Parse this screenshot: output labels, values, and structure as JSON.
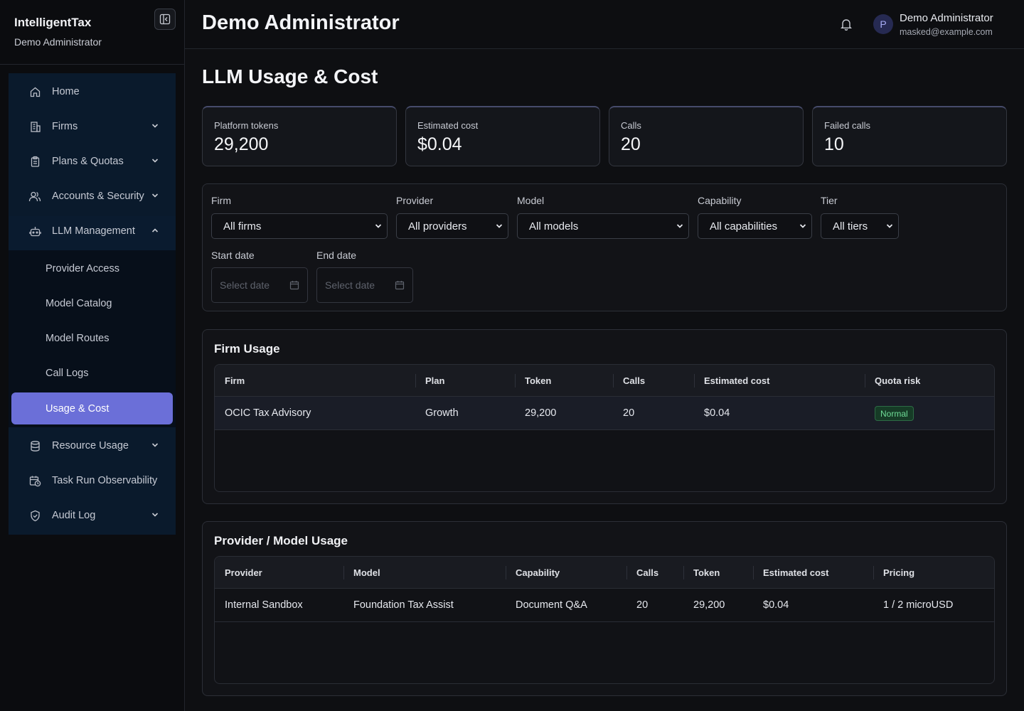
{
  "sidebar": {
    "brand_title": "IntelligentTax",
    "brand_subtitle": "Demo Administrator",
    "items": [
      {
        "label": "Home",
        "icon": "home-icon"
      },
      {
        "label": "Firms",
        "icon": "building-icon"
      },
      {
        "label": "Plans & Quotas",
        "icon": "clipboard-icon"
      },
      {
        "label": "Accounts & Security",
        "icon": "users-icon"
      },
      {
        "label": "LLM Management",
        "icon": "robot-icon"
      },
      {
        "label": "Resource Usage",
        "icon": "database-icon"
      },
      {
        "label": "Task Run Observability",
        "icon": "calendar-clock-icon"
      },
      {
        "label": "Audit Log",
        "icon": "shield-check-icon"
      }
    ],
    "llm_sub_items": [
      "Provider Access",
      "Model Catalog",
      "Model Routes",
      "Call Logs",
      "Usage & Cost"
    ],
    "active_item": "Usage & Cost"
  },
  "header": {
    "title": "Demo Administrator",
    "user_name": "Demo Administrator",
    "user_email": "masked@example.com",
    "avatar_initial": "P"
  },
  "page": {
    "title": "LLM Usage & Cost"
  },
  "stats": [
    {
      "label": "Platform tokens",
      "value": "29,200"
    },
    {
      "label": "Estimated cost",
      "value": "$0.04"
    },
    {
      "label": "Calls",
      "value": "20"
    },
    {
      "label": "Failed calls",
      "value": "10"
    }
  ],
  "filters": {
    "firm": {
      "label": "Firm",
      "value": "All firms"
    },
    "provider": {
      "label": "Provider",
      "value": "All providers"
    },
    "model": {
      "label": "Model",
      "value": "All models"
    },
    "capability": {
      "label": "Capability",
      "value": "All capabilities"
    },
    "tier": {
      "label": "Tier",
      "value": "All tiers"
    },
    "start_date": {
      "label": "Start date",
      "placeholder": "Select date"
    },
    "end_date": {
      "label": "End date",
      "placeholder": "Select date"
    }
  },
  "firm_usage": {
    "title": "Firm Usage",
    "columns": [
      "Firm",
      "Plan",
      "Token",
      "Calls",
      "Estimated cost",
      "Quota risk"
    ],
    "rows": [
      {
        "firm": "OCIC Tax Advisory",
        "plan": "Growth",
        "token": "29,200",
        "calls": "20",
        "cost": "$0.04",
        "risk": "Normal"
      }
    ]
  },
  "provider_usage": {
    "title": "Provider / Model Usage",
    "columns": [
      "Provider",
      "Model",
      "Capability",
      "Calls",
      "Token",
      "Estimated cost",
      "Pricing"
    ],
    "rows": [
      {
        "provider": "Internal Sandbox",
        "model": "Foundation Tax Assist",
        "capability": "Document Q&A",
        "calls": "20",
        "token": "29,200",
        "cost": "$0.04",
        "pricing": "1 / 2 microUSD"
      }
    ]
  },
  "colors": {
    "accent": "#6b6fd8",
    "badge_green": "#6fdc97",
    "background": "#0e0f12"
  }
}
